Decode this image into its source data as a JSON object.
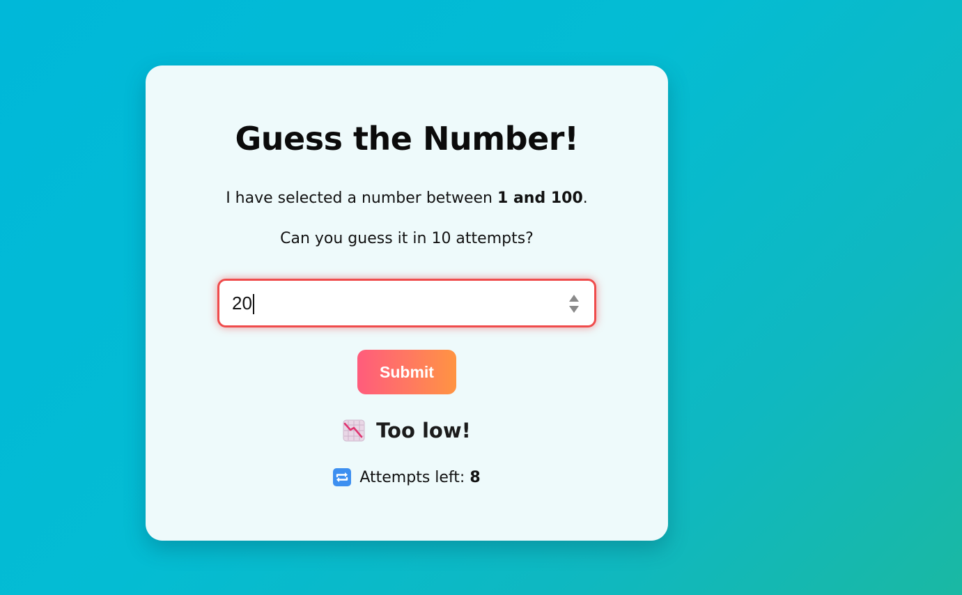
{
  "colors": {
    "accent_error": "#ef4b4b",
    "button_gradient_start": "#ff5c7c",
    "button_gradient_end": "#ff9442",
    "card_background": "#eefafb"
  },
  "game": {
    "title": "Guess the Number!",
    "intro_prefix": "I have selected a number between ",
    "intro_range": "1 and 100",
    "intro_suffix": ".",
    "challenge": "Can you guess it in 10 attempts?",
    "input_value": "20",
    "submit_label": "Submit",
    "feedback_icon": "chart-decreasing-icon",
    "feedback": "Too low!",
    "attempts_icon": "repeat-icon",
    "attempts_label": "Attempts left: ",
    "attempts_left": "8"
  }
}
